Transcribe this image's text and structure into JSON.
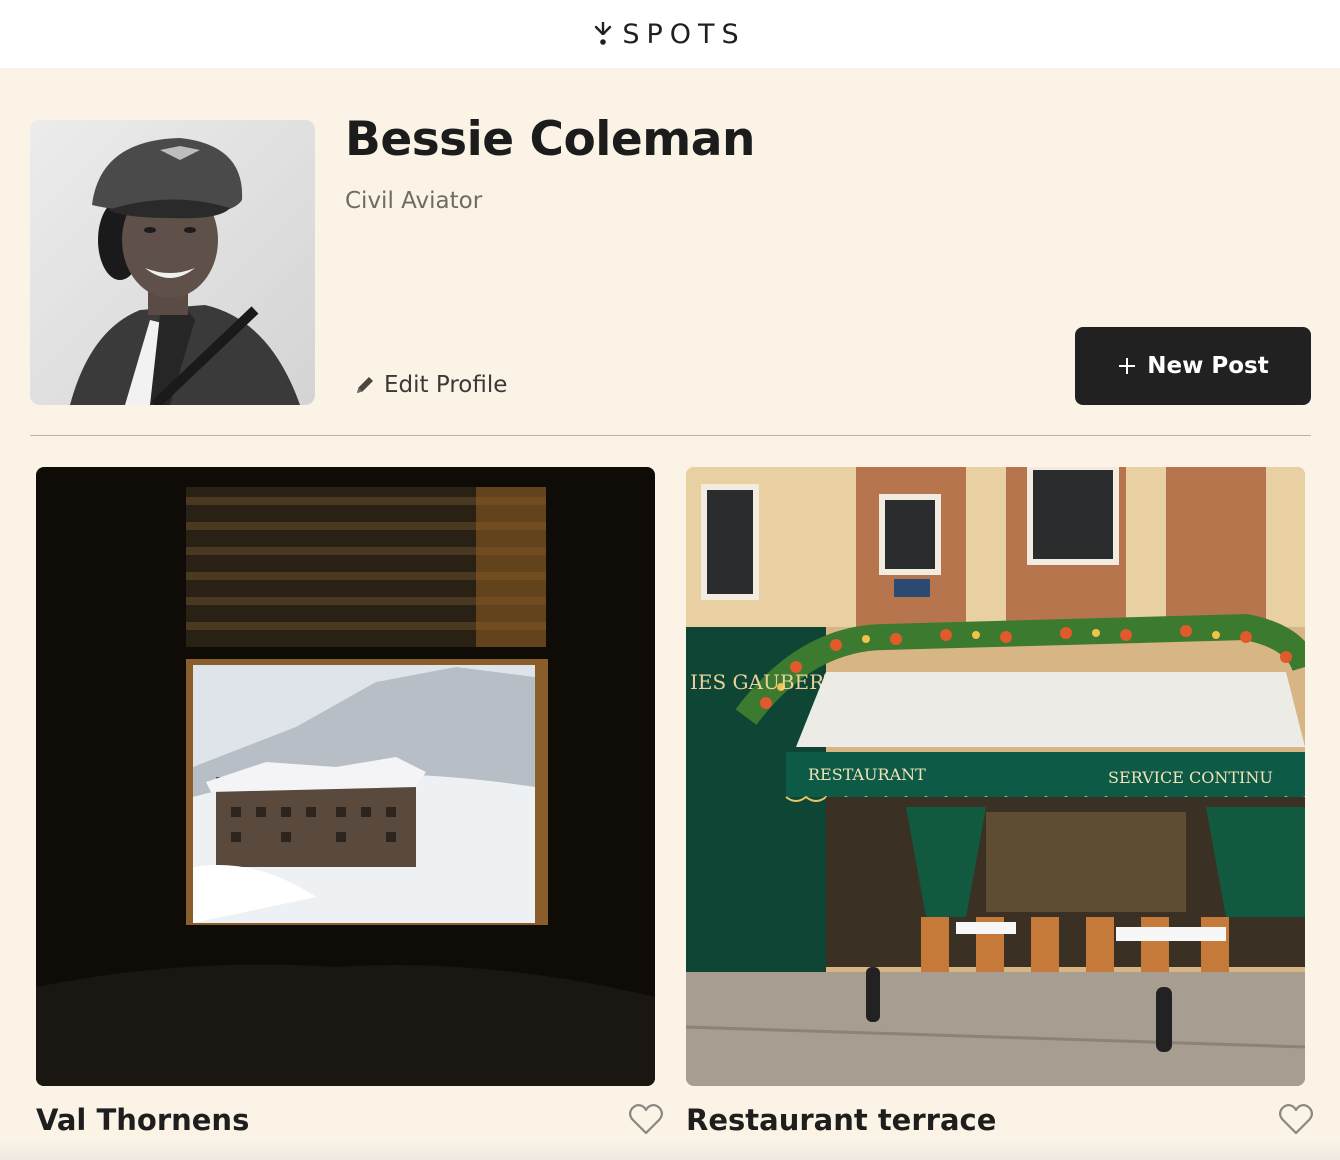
{
  "header": {
    "logo_text": "SPOTS",
    "logo_icon": "sprout-arrow-icon"
  },
  "profile": {
    "name": "Bessie Coleman",
    "role": "Civil Aviator",
    "edit_label": "Edit Profile",
    "new_post_label": "New Post",
    "avatar_icon": "portrait-photo"
  },
  "cards": [
    {
      "title": "Val Thornens",
      "image": "snowy-village-through-window-photo",
      "like_icon": "heart-outline-icon"
    },
    {
      "title": "Restaurant terrace",
      "image": "paris-cafe-terrace-photo",
      "like_icon": "heart-outline-icon"
    }
  ],
  "photo_signs": {
    "awning_left": "RESTAURANT",
    "awning_right": "SERVICE CONTINU",
    "storefront": "IES GAUBERT"
  },
  "colors": {
    "background": "#faf3e6",
    "header": "#ffffff",
    "button": "#212121",
    "awning_green": "#0d5a47"
  }
}
